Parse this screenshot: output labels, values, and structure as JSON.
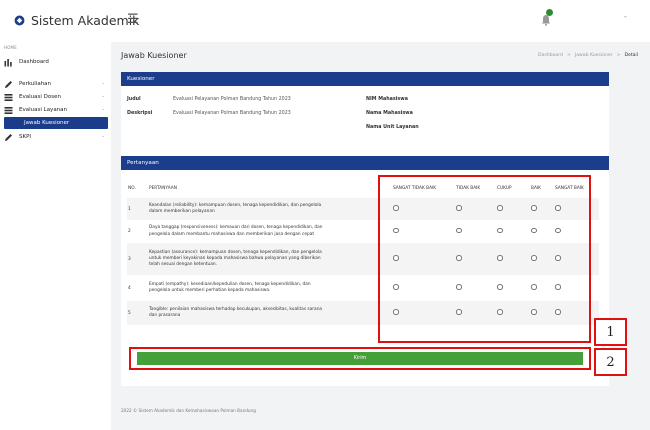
{
  "app": {
    "title": "Sistem Akademik",
    "menu_icon": "hamburger-icon",
    "notification_icon": "bell-icon",
    "user_caret": "-"
  },
  "sidebar": {
    "section_label": "HOME",
    "items": [
      {
        "label": "Dashboard",
        "icon": "chart-icon"
      },
      {
        "label": "Perkuliahan",
        "icon": "pencil-icon",
        "caret": "-"
      },
      {
        "label": "Evaluasi Dosen",
        "icon": "list-icon",
        "caret": "-"
      },
      {
        "label": "Evaluasi Layanan",
        "icon": "list-icon",
        "caret": "-"
      },
      {
        "label": "Jawab Kuesioner",
        "active": true
      },
      {
        "label": "SKPI",
        "icon": "pencil-icon",
        "caret": "-"
      }
    ]
  },
  "page": {
    "title": "Jawab Kuesioner",
    "breadcrumb": [
      "Dashboard",
      "Jawab Kuesioner",
      "Detail"
    ],
    "breadcrumb_sep": ">"
  },
  "kuesioner": {
    "header": "Kuesioner",
    "judul_label": "Judul",
    "judul_value": "Evaluasi Pelayanan Polman Bandung Tahun 2023",
    "deskripsi_label": "Deskripsi",
    "deskripsi_value": "Evaluasi Pelayanan Polman Bandung Tahun 2023",
    "nim_label": "NIM Mahasiswa",
    "nama_label": "Nama Mahasiswa",
    "unit_label": "Nama Unit Layanan"
  },
  "pertanyaan": {
    "header": "Pertanyaan",
    "columns": [
      "NO.",
      "PERTANYAAN",
      "SANGAT TIDAK BAIK",
      "TIDAK BAIK",
      "CUKUP",
      "BAIK",
      "SANGAT BAIK"
    ],
    "rows": [
      {
        "no": "1",
        "lines": [
          "Keandalan (reliability): kemampuan dosen, tenaga kependidikan, dan pengelola",
          "dalam memberikan pelayanan"
        ]
      },
      {
        "no": "2",
        "lines": [
          "Daya tanggap (responsiveness): kemauan dari dosen, tenaga kependidikan, dan",
          "pengelola dalam membantu mahasiswa dan memberikan jasa dengan cepat"
        ]
      },
      {
        "no": "3",
        "lines": [
          "Kepastian (assurance): kemampuan dosen, tenaga kependidikan, dan pengelola",
          "untuk memberi keyakinan kepada mahasiswa bahwa pelayanan yang diberikan",
          "telah sesuai dengan ketentuan."
        ]
      },
      {
        "no": "4",
        "lines": [
          "Empati (empathy): kesediaan/kepedulian dosen, tenaga kependidikan, dan",
          "pengelola untuk memberi perhatian kepada mahasiswa."
        ]
      },
      {
        "no": "5",
        "lines": [
          "Tangible: penilaian mahasiswa terhadap kecukupan, aksesibitas, kualitas sarana",
          "dan prasarana"
        ]
      }
    ]
  },
  "submit_label": "Kirim",
  "annotations": {
    "box1": "1",
    "box2": "2"
  },
  "footer": "2022 © Sistem Akademik dan Kemahasiswaan Polman Bandung",
  "colors": {
    "primary": "#1b3d8b",
    "submit": "#45a03a",
    "annotation": "#e01010"
  }
}
